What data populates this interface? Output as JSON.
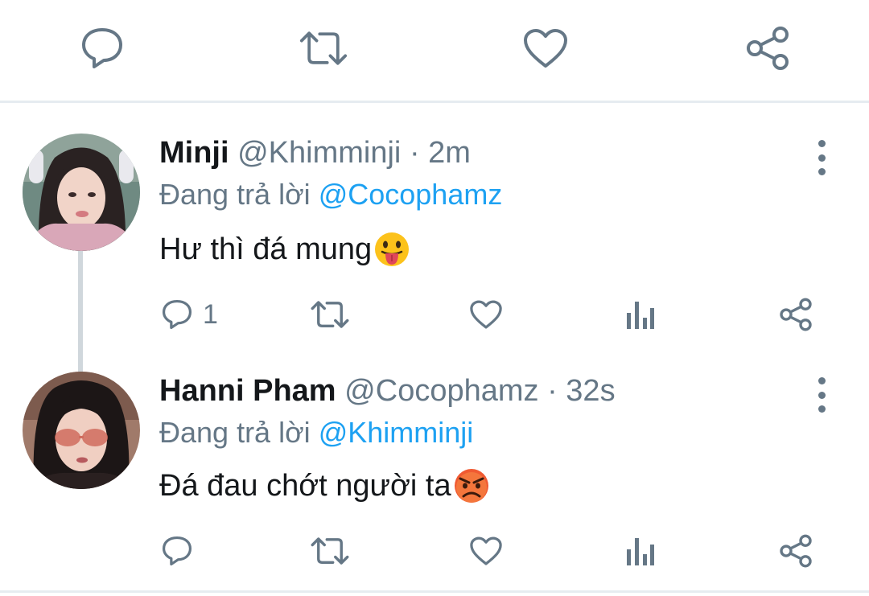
{
  "top_actions": [
    "reply-icon",
    "retweet-icon",
    "like-icon",
    "share-icon"
  ],
  "colors": {
    "icon_gray": "#657786",
    "mention_blue": "#1da1f2",
    "divider": "#e6ecf0"
  },
  "tweets": [
    {
      "name": "Minji",
      "handle": "@Khimminji",
      "separator": "·",
      "time": "2m",
      "replying_prefix": "Đang trả lời",
      "replying_to": "@Cocophamz",
      "text": "Hư thì đá mung",
      "emoji": "face-with-tongue",
      "reply_count": "1"
    },
    {
      "name": "Hanni Pham",
      "handle": "@Cocophamz",
      "separator": "·",
      "time": "32s",
      "replying_prefix": "Đang trả lời",
      "replying_to": "@Khimminji",
      "text": "Đá đau chớt người ta",
      "emoji": "angry-face",
      "reply_count": ""
    }
  ]
}
